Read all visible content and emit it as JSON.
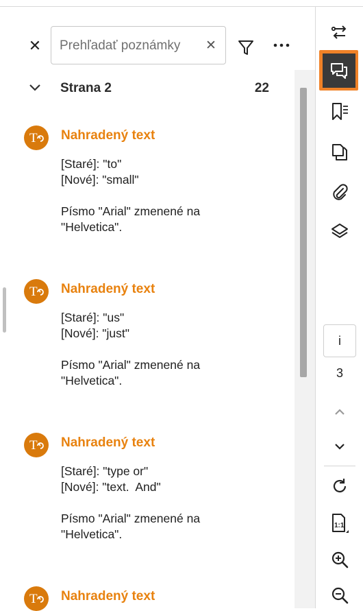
{
  "search": {
    "placeholder": "Prehľadať poznámky"
  },
  "group": {
    "title": "Strana 2",
    "count": "22"
  },
  "comments": [
    {
      "title": "Nahradený text",
      "old": "[Staré]: \"to\"",
      "new": "[Nové]: \"small\"",
      "note1": "Písmo \"Arial\" zmenené na",
      "note2": "\"Helvetica\"."
    },
    {
      "title": "Nahradený text",
      "old": "[Staré]: \"us\"",
      "new": "[Nové]: \"just\"",
      "note1": "Písmo \"Arial\" zmenené na",
      "note2": "\"Helvetica\"."
    },
    {
      "title": "Nahradený text",
      "old": "[Staré]: \"type or\"",
      "new": "[Nové]: \"text.  And\"",
      "note1": "Písmo \"Arial\" zmenené na",
      "note2": "\"Helvetica\"."
    },
    {
      "title": "Nahradený text"
    }
  ],
  "pager": {
    "current": "i",
    "total": "3"
  },
  "colors": {
    "accent": "#e8820f",
    "avatar": "#d97a0c",
    "active_outline": "#f08228",
    "active_fill": "#3a3a3a"
  },
  "icons": {
    "rail": [
      "compare-icon",
      "comments-icon",
      "bookmarks-icon",
      "pages-icon",
      "attachments-icon",
      "layers-icon",
      "chevron-up-icon",
      "chevron-down-icon",
      "rotate-icon",
      "actual-size-icon",
      "zoom-in-icon",
      "zoom-out-icon"
    ]
  }
}
